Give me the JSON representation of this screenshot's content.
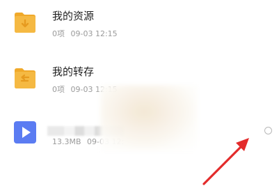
{
  "files": [
    {
      "name": "我的资源",
      "count": "0项",
      "date": "09-03 12:15",
      "icon": "folder-icon"
    },
    {
      "name": "我的转存",
      "count": "0项",
      "date": "09-03 12:15",
      "icon": "folder-icon"
    },
    {
      "name": "",
      "size": "13.3MB",
      "date": "09-03 12:",
      "icon": "video-icon"
    }
  ],
  "colors": {
    "folder": "#f5b943",
    "folder_tab": "#f0a92a",
    "folder_mark": "#e69a1f",
    "video": "#5b7cf2",
    "annotation_arrow": "#e32b2b"
  }
}
